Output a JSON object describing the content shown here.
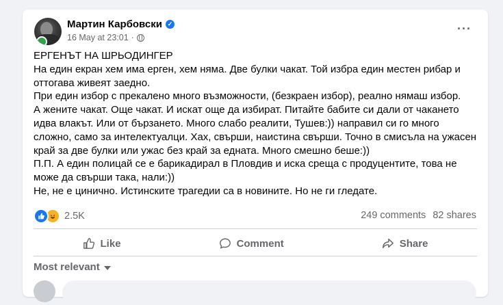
{
  "post": {
    "author": "Мартин Карбовски",
    "timestamp": "16 May at 23:01",
    "dot": "·",
    "more_label": "···",
    "text": [
      "ЕРГЕНЪТ НА ШРЬОДИНГЕР",
      "На един екран хем има ерген, хем няма. Две булки чакат. Той избра един местен рибар и оттогава живеят заедно.",
      "При един избор с прекалено много възможности, (безкраен избор), реално нямаш избор.",
      "А жените чакат. Още чакат. И искат още да избират. Питайте бабите си дали от чакането идва влакът. Или от бързането. Много слабо реалити, Тушев:)) направил си го много сложно, само за интелектуалци. Хах, свърши, наистина свърши. Точно в смисъла на ужасен край за две булки или ужас без край за едната. Много смешно беше:))",
      "П.П. А един полицай се е барикадирал в Пловдив и иска среща с продуцентите, това не може да свърши така, нали:))",
      "Не, не е цинично. Истинските трагедии са в новините. Но не ги гледате."
    ]
  },
  "stats": {
    "reactions": "2.5K",
    "comments": "249 comments",
    "shares": "82 shares"
  },
  "actions": {
    "like": "Like",
    "comment": "Comment",
    "share": "Share"
  },
  "comments_filter": "Most relevant",
  "colors": {
    "accent": "#1877f2",
    "online": "#31a24c",
    "muted": "#65676b",
    "background": "#f0f2f5"
  }
}
